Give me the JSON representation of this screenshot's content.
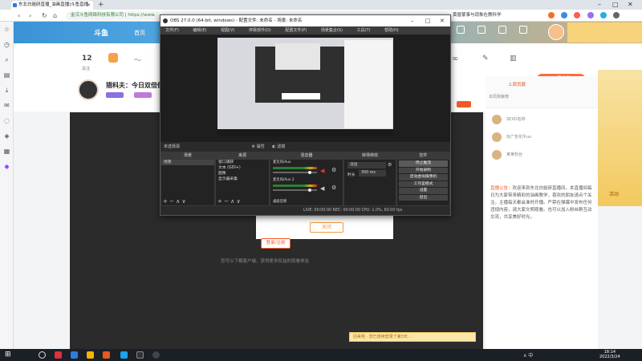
{
  "browser": {
    "tab_title": "东北白姐研直播_油画直播|斗鱼直播",
    "tab_close": "×",
    "new_tab": "+",
    "url_prefix": "金汉斗鱼网络科技有限公司",
    "url": "https://www.",
    "right_status": "黄昏蒙事与现象在教科学",
    "minimize": "–",
    "maximize": "□",
    "close": "✕"
  },
  "douyu": {
    "logo": "斗鱼",
    "nav_first": "首页",
    "stat_follow": "12",
    "stat_follow_label": "关注",
    "streamer_title": "猎科夫：今日双倍倒",
    "pc_button": "PC客户端",
    "login_button": "登录/注册",
    "close_button": "关闭",
    "hint_text": "您可以下载客户端，获得更多权益的观看体验",
    "toast": "回来啦 · 您已连续登录了第3天…",
    "notice_label": "直播公告：",
    "notice": "欢迎来到东北白姐研直播间，本直播间每日为大家带来精彩的油画教学，喜欢的朋友请点个关注，主播每天都会准时开播。严禁在弹幕中发布任何违规内容，请大家文明观看。也可以加入粉丝群互动交流，共享美好时光。",
    "rank_names": [
      "SEXD名称",
      "玩广告花牛uu",
      "某某粉丝"
    ],
    "right_top": "上周贡献",
    "right_sub": "本周贡献榜",
    "promo_text": "活动"
  },
  "obs": {
    "title": "OBS 27.0.0 (64-bit, windows) - 配置文件: 未命名 - 场景: 未命名",
    "menu": [
      "文件(F)",
      "编辑(E)",
      "视图(V)",
      "停靠部件(D)",
      "配置文件(P)",
      "场景集合(S)",
      "工具(T)",
      "帮助(H)"
    ],
    "ctrl_no_source": "未选择源",
    "ctrl_props": "属性",
    "ctrl_filters": "滤镜",
    "docks": {
      "scenes": "场景",
      "sources": "来源",
      "mixer": "混音器",
      "transitions": "转场特效",
      "controls": "控件"
    },
    "scene_item": "场景",
    "sources": [
      "窗口捕获",
      "文本 (GDI+)",
      "图像",
      "显示器采集"
    ],
    "mixer_tracks": [
      {
        "name": "麦克风/Aux",
        "db": "0.0 dB"
      },
      {
        "name": "麦克风/Aux 2",
        "db": "0.0 dB"
      },
      {
        "name": "桌面音频",
        "db": "0.0 dB"
      }
    ],
    "transition_type": "淡出",
    "duration_label": "时长",
    "duration_value": "300 ms",
    "controls": [
      "停止推流",
      "开始录制",
      "启动虚拟摄像机",
      "工作室模式",
      "设置",
      "退出"
    ],
    "status": "LIVE: 00:00:00   REC: 00:00:00   CPU: 1.0%, 60.00 fps",
    "footer_icons": "+ − ∧ ∨"
  },
  "taskbar": {
    "time": "18:14",
    "date": "2022/3/24",
    "tray": "∧ 中"
  },
  "colors": {
    "accent": "#f05a28",
    "obs_bg": "#2b2b2b",
    "taskbar": "#1b1f26"
  }
}
